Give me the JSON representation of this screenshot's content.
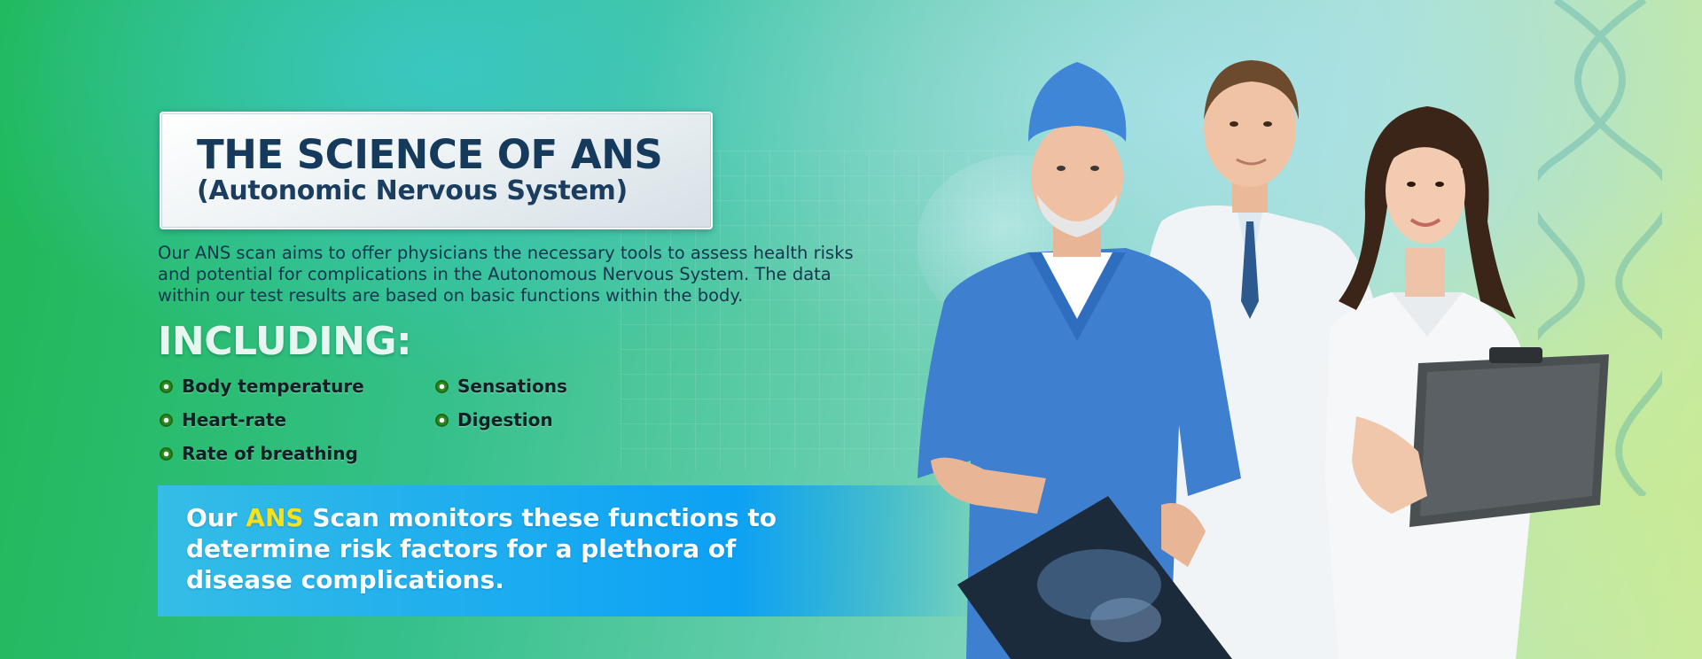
{
  "title": {
    "main": "THE SCIENCE OF ANS",
    "sub": "(Autonomic Nervous System)"
  },
  "intro": {
    "line1": "Our ANS scan aims to offer physicians the necessary tools to assess health risks",
    "line2": "and potential for complications in the Autonomous Nervous System. The data",
    "line3": "within our test results are based on basic functions within the body."
  },
  "including_heading": "INCLUDING:",
  "features": {
    "items": [
      {
        "label": "Body temperature"
      },
      {
        "label": "Heart-rate"
      },
      {
        "label": "Rate of breathing"
      },
      {
        "label": "Sensations"
      },
      {
        "label": "Digestion"
      }
    ]
  },
  "callout": {
    "prefix": "Our ",
    "highlight": "ANS",
    "line1_rest": " Scan monitors these functions to",
    "line2": "determine risk factors for a plethora of",
    "line3": "disease complications."
  },
  "colors": {
    "title_text": "#163a5b",
    "bullet_green": "#2a8a1d",
    "callout_blue": "#0da1f5",
    "highlight_yellow": "#f7e11b"
  }
}
